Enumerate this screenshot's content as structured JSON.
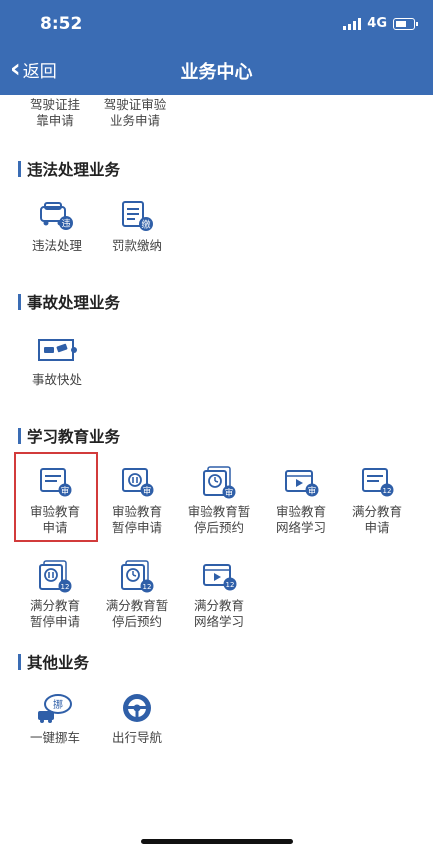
{
  "status": {
    "time": "8:52",
    "network": "4G"
  },
  "nav": {
    "back_label": "返回",
    "title": "业务中心"
  },
  "sections": [
    {
      "title": "违法处理业务"
    },
    {
      "title": "事故处理业务"
    },
    {
      "title": "学习教育业务"
    },
    {
      "title": "其他业务"
    }
  ],
  "items": {
    "top1": "驾驶证挂\n靠申请",
    "top2": "驾驶证审验\n业务申请",
    "violation": "违法处理",
    "fine": "罚款缴纳",
    "accident_fast": "事故快处",
    "review_edu_apply": "审验教育\n申请",
    "review_edu_pause": "审验教育\n暂停申请",
    "review_edu_resume": "审验教育暂\n停后预约",
    "review_edu_online": "审验教育\n网络学习",
    "full_edu_apply": "满分教育\n申请",
    "full_edu_pause": "满分教育\n暂停申请",
    "full_edu_resume": "满分教育暂\n停后预约",
    "full_edu_online": "满分教育\n网络学习",
    "move_car": "一键挪车",
    "navigation": "出行导航"
  },
  "badges": {
    "review": "审",
    "violation": "违",
    "fine": "缴",
    "full": "12",
    "move": "挪"
  },
  "colors": {
    "header": "#3a6cb4",
    "icon": "#2f5fa8",
    "highlight": "#d23b3b"
  }
}
